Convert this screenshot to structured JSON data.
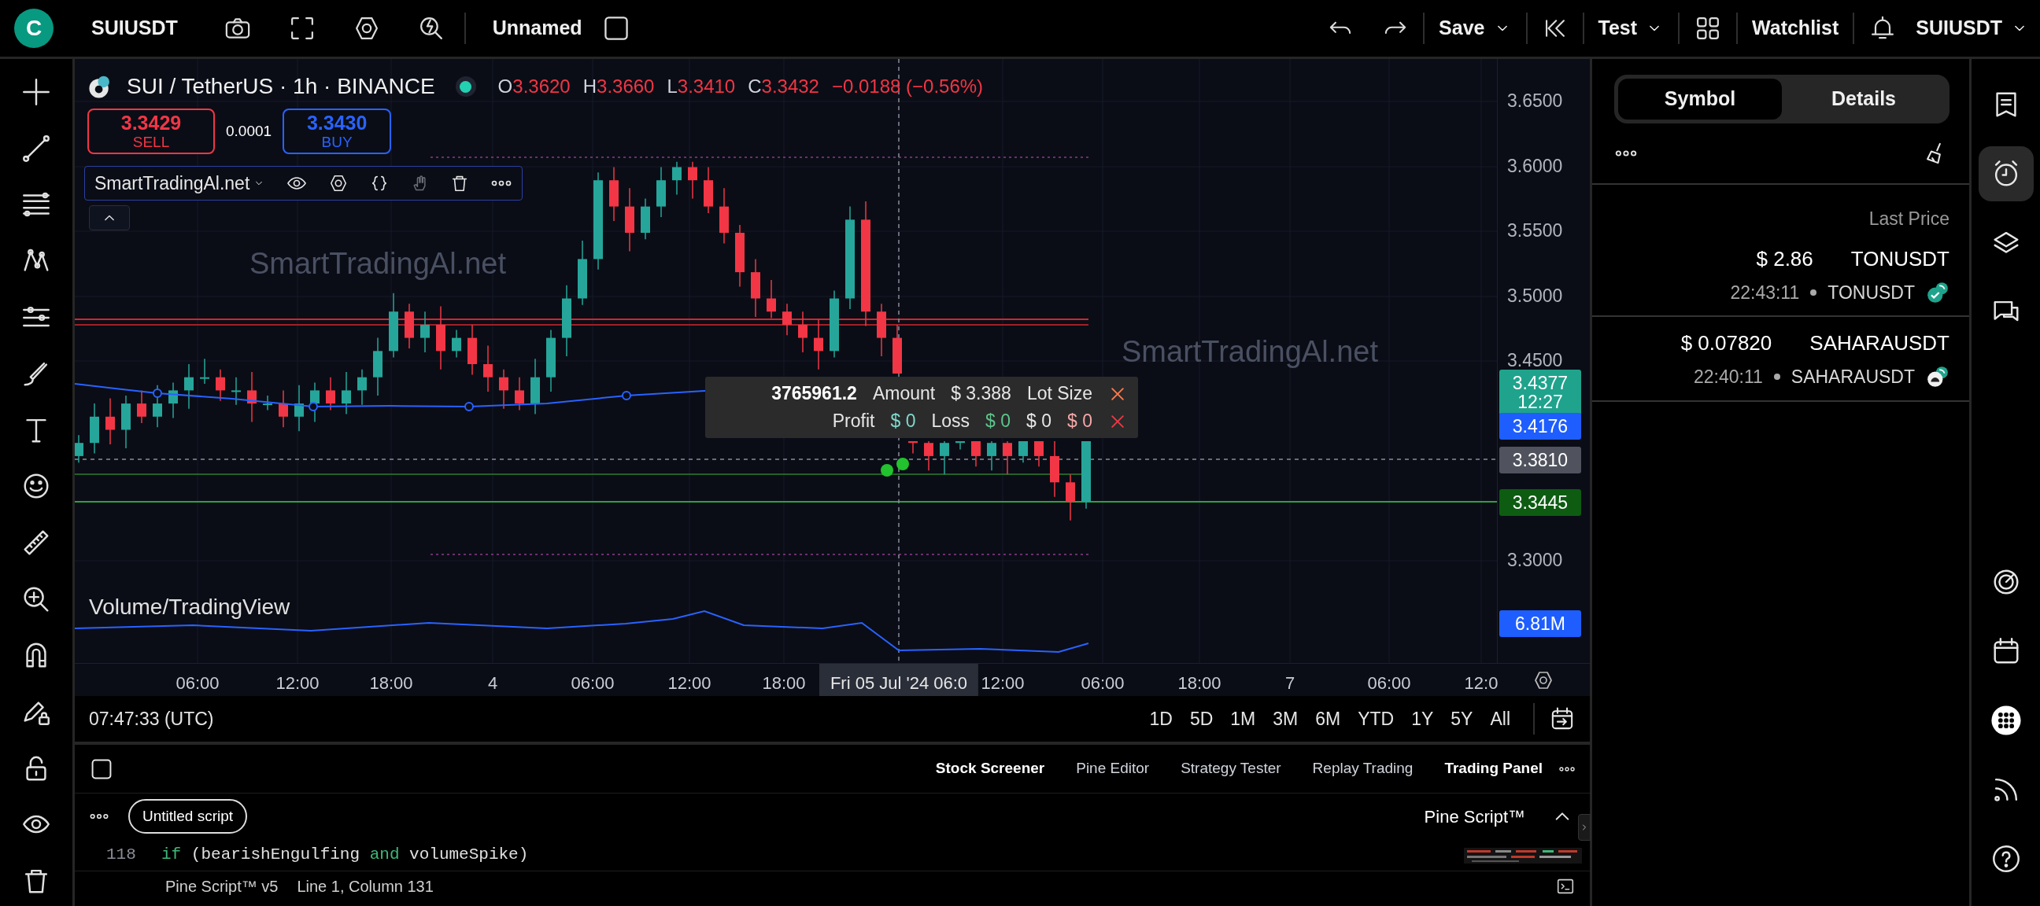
{
  "topbar": {
    "logo": "C",
    "symbol": "SUIUSDT",
    "layout_name": "Unnamed",
    "save": "Save",
    "test": "Test",
    "watchlist": "Watchlist",
    "account": "SUIUSDT"
  },
  "chart": {
    "title": "SUI / TetherUS · 1h · BINANCE",
    "market_open": true,
    "ohlc": [
      {
        "label": "O",
        "value": "3.3620"
      },
      {
        "label": "H",
        "value": "3.3660"
      },
      {
        "label": "L",
        "value": "3.3410"
      },
      {
        "label": "C",
        "value": "3.3432"
      }
    ],
    "change": "−0.0188 (−0.56%)",
    "sell": {
      "price": "3.3429",
      "label": "SELL"
    },
    "spread": "0.0001",
    "buy": {
      "price": "3.3430",
      "label": "BUY"
    },
    "indicator": "SmartTradingAl.net",
    "watermarks": [
      "SmartTradingAl.net",
      "SmartTradingAl.net"
    ],
    "volume_label": "Volume/TradingView",
    "order_panel": {
      "quantity": "3765961.2",
      "amount_label": "Amount",
      "amount": "$ 3.388",
      "lot_size_label": "Lot Size",
      "profit_label": "Profit",
      "loss_label": "Loss",
      "values": [
        {
          "text": "$ 0",
          "color": "#7fd8cc"
        },
        {
          "text": "$ 0",
          "color": "#5cc48a"
        },
        {
          "text": "$ 0",
          "color": "#e6e6e6"
        },
        {
          "text": "$ 0",
          "color": "#f4a6a6"
        }
      ]
    },
    "price_axis": [
      {
        "text": "3.6500",
        "kind": "tick"
      },
      {
        "text": "3.6000",
        "kind": "tick"
      },
      {
        "text": "3.5500",
        "kind": "tick"
      },
      {
        "text": "3.5000",
        "kind": "tick"
      },
      {
        "text": "3.4500",
        "kind": "tick"
      },
      {
        "text": "3.4377",
        "sub": "12:27",
        "kind": "badge",
        "color": "#1fa38c"
      },
      {
        "text": "3.4176",
        "kind": "badge",
        "color": "#1e5eff"
      },
      {
        "text": "3.3810",
        "kind": "badge",
        "color": "#50535e"
      },
      {
        "text": "3.3445",
        "kind": "badge",
        "color": "#0d5c12"
      },
      {
        "text": "3.3000",
        "kind": "tick"
      },
      {
        "text": "6.81M",
        "kind": "badge",
        "color": "#1e5eff"
      }
    ],
    "time_axis": [
      {
        "text": "06:00",
        "kind": "tick"
      },
      {
        "text": "12:00",
        "kind": "tick"
      },
      {
        "text": "18:00",
        "kind": "tick"
      },
      {
        "text": "4",
        "kind": "tick"
      },
      {
        "text": "06:00",
        "kind": "tick"
      },
      {
        "text": "12:00",
        "kind": "tick"
      },
      {
        "text": "18:00",
        "kind": "tick"
      },
      {
        "text": "Fri 05 Jul '24  06:0",
        "kind": "crosshair"
      },
      {
        "text": "12:00",
        "kind": "tick"
      },
      {
        "text": "06:00",
        "kind": "tick"
      },
      {
        "text": "18:00",
        "kind": "tick"
      },
      {
        "text": "7",
        "kind": "tick"
      },
      {
        "text": "06:00",
        "kind": "tick"
      },
      {
        "text": "12:0",
        "kind": "tick"
      }
    ]
  },
  "timebar": {
    "clock": "07:47:33 (UTC)",
    "ranges": [
      "1D",
      "5D",
      "1M",
      "3M",
      "6M",
      "YTD",
      "1Y",
      "5Y",
      "All"
    ]
  },
  "bottom_panel": {
    "tabs": [
      {
        "label": "Stock Screener",
        "selected": true
      },
      {
        "label": "Pine Editor",
        "selected": false
      },
      {
        "label": "Strategy Tester",
        "selected": false
      },
      {
        "label": "Replay Trading",
        "selected": false
      },
      {
        "label": "Trading Panel",
        "selected": true
      }
    ],
    "script_name": "Untitled script",
    "language": "Pine Script™",
    "code": {
      "line_number": "118",
      "tokens": [
        {
          "text": "if",
          "kind": "keyword"
        },
        {
          "text": " (bearishEngulfing ",
          "kind": "plain"
        },
        {
          "text": "and",
          "kind": "keyword"
        },
        {
          "text": " volumeSpike)",
          "kind": "plain"
        }
      ]
    },
    "status": {
      "version": "Pine Script™ v5",
      "cursor": "Line 1, Column 131"
    }
  },
  "right_panel": {
    "tabs": [
      {
        "label": "Symbol",
        "selected": true
      },
      {
        "label": "Details",
        "selected": false
      }
    ],
    "column_header": "Last Price",
    "rows": [
      {
        "price": "$ 2.86",
        "symbol": "TONUSDT",
        "time": "22:43:11",
        "source": "TONUSDT",
        "kind": "check"
      },
      {
        "price": "$ 0.07820",
        "symbol": "SAHARAUSDT",
        "time": "22:40:11",
        "source": "SAHARAUSDT",
        "kind": "pending"
      }
    ]
  },
  "rail": [
    {
      "selected": false
    },
    {
      "selected": true
    },
    {
      "selected": false
    },
    {
      "selected": false
    },
    {
      "selected": false
    },
    {
      "selected": false
    },
    {
      "selected": false
    },
    {
      "selected": false
    },
    {
      "selected": false
    }
  ]
}
